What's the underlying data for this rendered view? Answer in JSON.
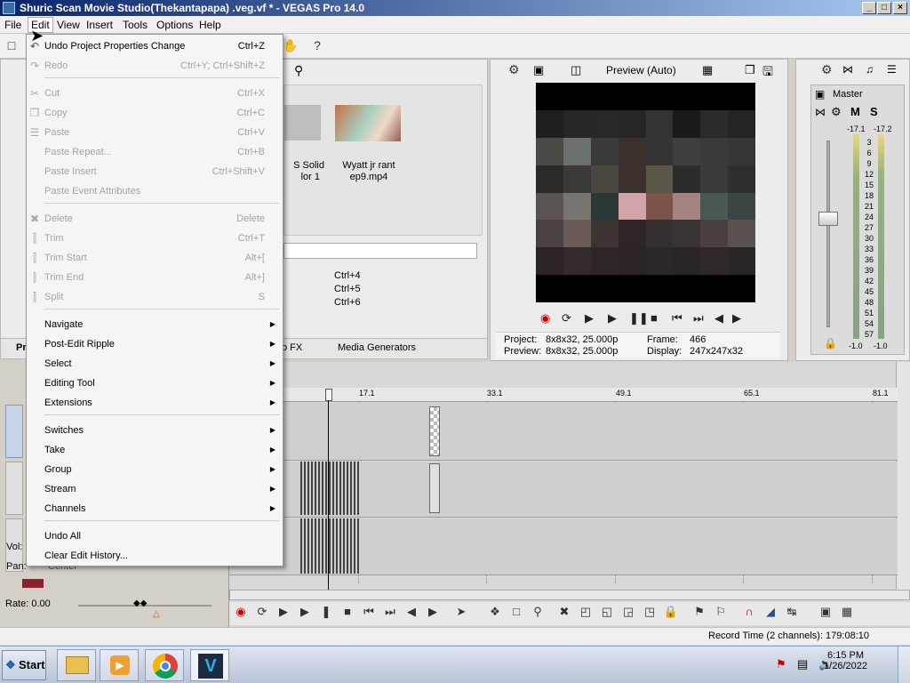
{
  "window": {
    "title": "Shuric Scan Movie Studio(Thekantapapa) .veg.vf * - VEGAS Pro 14.0",
    "controls": [
      "_",
      "□",
      "×"
    ]
  },
  "menubar": {
    "items": [
      "File",
      "Edit",
      "View",
      "Insert",
      "Tools",
      "Options",
      "Help"
    ]
  },
  "edit_menu": {
    "items": [
      {
        "label": "Undo Project Properties Change",
        "shortcut": "Ctrl+Z",
        "enabled": true,
        "icon": "undo-icon"
      },
      {
        "label": "Redo",
        "shortcut": "Ctrl+Y; Ctrl+Shift+Z",
        "enabled": false,
        "icon": "redo-icon"
      },
      {
        "label": "Cut",
        "shortcut": "Ctrl+X",
        "enabled": false,
        "icon": "cut-icon"
      },
      {
        "label": "Copy",
        "shortcut": "Ctrl+C",
        "enabled": false,
        "icon": "copy-icon"
      },
      {
        "label": "Paste",
        "shortcut": "Ctrl+V",
        "enabled": false,
        "icon": "paste-icon"
      },
      {
        "label": "Paste Repeat...",
        "shortcut": "Ctrl+B",
        "enabled": false
      },
      {
        "label": "Paste Insert",
        "shortcut": "Ctrl+Shift+V",
        "enabled": false
      },
      {
        "label": "Paste Event Attributes",
        "shortcut": "",
        "enabled": false
      },
      {
        "label": "Delete",
        "shortcut": "Delete",
        "enabled": false,
        "icon": "delete-icon"
      },
      {
        "label": "Trim",
        "shortcut": "Ctrl+T",
        "enabled": false,
        "icon": "trim-icon"
      },
      {
        "label": "Trim Start",
        "shortcut": "Alt+[",
        "enabled": false,
        "icon": "trim-start-icon"
      },
      {
        "label": "Trim End",
        "shortcut": "Alt+]",
        "enabled": false,
        "icon": "trim-end-icon"
      },
      {
        "label": "Split",
        "shortcut": "S",
        "enabled": false,
        "icon": "split-icon"
      },
      {
        "label": "Navigate",
        "submenu": true,
        "enabled": true
      },
      {
        "label": "Post-Edit Ripple",
        "submenu": true,
        "enabled": true
      },
      {
        "label": "Select",
        "submenu": true,
        "enabled": true
      },
      {
        "label": "Editing Tool",
        "submenu": true,
        "enabled": true
      },
      {
        "label": "Extensions",
        "submenu": true,
        "enabled": true
      },
      {
        "label": "Switches",
        "submenu": true,
        "enabled": true
      },
      {
        "label": "Take",
        "submenu": true,
        "enabled": true
      },
      {
        "label": "Group",
        "submenu": true,
        "enabled": true
      },
      {
        "label": "Stream",
        "submenu": true,
        "enabled": true
      },
      {
        "label": "Channels",
        "submenu": true,
        "enabled": true
      },
      {
        "label": "Undo All",
        "enabled": true
      },
      {
        "label": "Clear Edit History...",
        "enabled": true
      }
    ]
  },
  "media": {
    "items": [
      {
        "label_line1": "S Solid",
        "label_line2": "lor 1"
      },
      {
        "label_line1": "Wyatt jr rant",
        "label_line2": "ep9.mp4"
      }
    ],
    "shortcuts": [
      "Ctrl+4",
      "Ctrl+5",
      "Ctrl+6"
    ],
    "tabs": [
      "Pr",
      "o FX",
      "Media Generators"
    ]
  },
  "preview": {
    "mode": "Preview (Auto)",
    "project_label": "Project:",
    "project_value": "8x8x32, 25.000p",
    "preview_label": "Preview:",
    "preview_value": "8x8x32, 25.000p",
    "frame_label": "Frame:",
    "frame_value": "466",
    "display_label": "Display:",
    "display_value": "247x247x32",
    "pixels": [
      "#000000",
      "#000000",
      "#000000",
      "#000000",
      "#000000",
      "#000000",
      "#000000",
      "#000000",
      "#1e1e1e",
      "#262626",
      "#282828",
      "#262626",
      "#333333",
      "#1a1a1a",
      "#2a2a2a",
      "#242424",
      "#4a4a44",
      "#6a7070",
      "#3a3a3a",
      "#3a302c",
      "#343434",
      "#3e3e3e",
      "#3a3a3a",
      "#363636",
      "#2c2a28",
      "#3c3a38",
      "#4a4640",
      "#3e302c",
      "#5a5648",
      "#2c2c2c",
      "#3a3a3a",
      "#2e2e2e",
      "#5a5450",
      "#7a7470",
      "#2c3838",
      "#d0a4a8",
      "#7a5448",
      "#a48480",
      "#4a5854",
      "#3c4444",
      "#4a4240",
      "#6a5a58",
      "#3c3430",
      "#2e2626",
      "#343030",
      "#383434",
      "#4a4040",
      "#5a5250",
      "#2a2426",
      "#322a2c",
      "#2c2628",
      "#2a2424",
      "#2c2828",
      "#2a2626",
      "#2e282a",
      "#2a2626",
      "#000000",
      "#000000",
      "#000000",
      "#000000",
      "#000000",
      "#000000",
      "#000000",
      "#000000"
    ]
  },
  "master": {
    "title": "Master",
    "M": "M",
    "S": "S",
    "peak_left": "-17.1",
    "peak_right": "-17.2",
    "scale": [
      "3",
      "6",
      "9",
      "12",
      "15",
      "18",
      "21",
      "24",
      "27",
      "30",
      "33",
      "36",
      "39",
      "42",
      "45",
      "48",
      "51",
      "54",
      "57"
    ],
    "bottom_left": "-1.0",
    "bottom_right": "-1.0"
  },
  "timeline": {
    "ruler": [
      "17.1",
      "33.1",
      "49.1",
      "65.1",
      "81.1"
    ],
    "vol_label": "Vol:",
    "pan_label": "Pan:",
    "pan_value": "Center",
    "rate_label": "Rate: 0.00"
  },
  "status": {
    "record_time": "Record Time (2 channels): 179:08:10"
  },
  "taskbar": {
    "start": "Start",
    "time": "6:15 PM",
    "date": "1/26/2022"
  }
}
